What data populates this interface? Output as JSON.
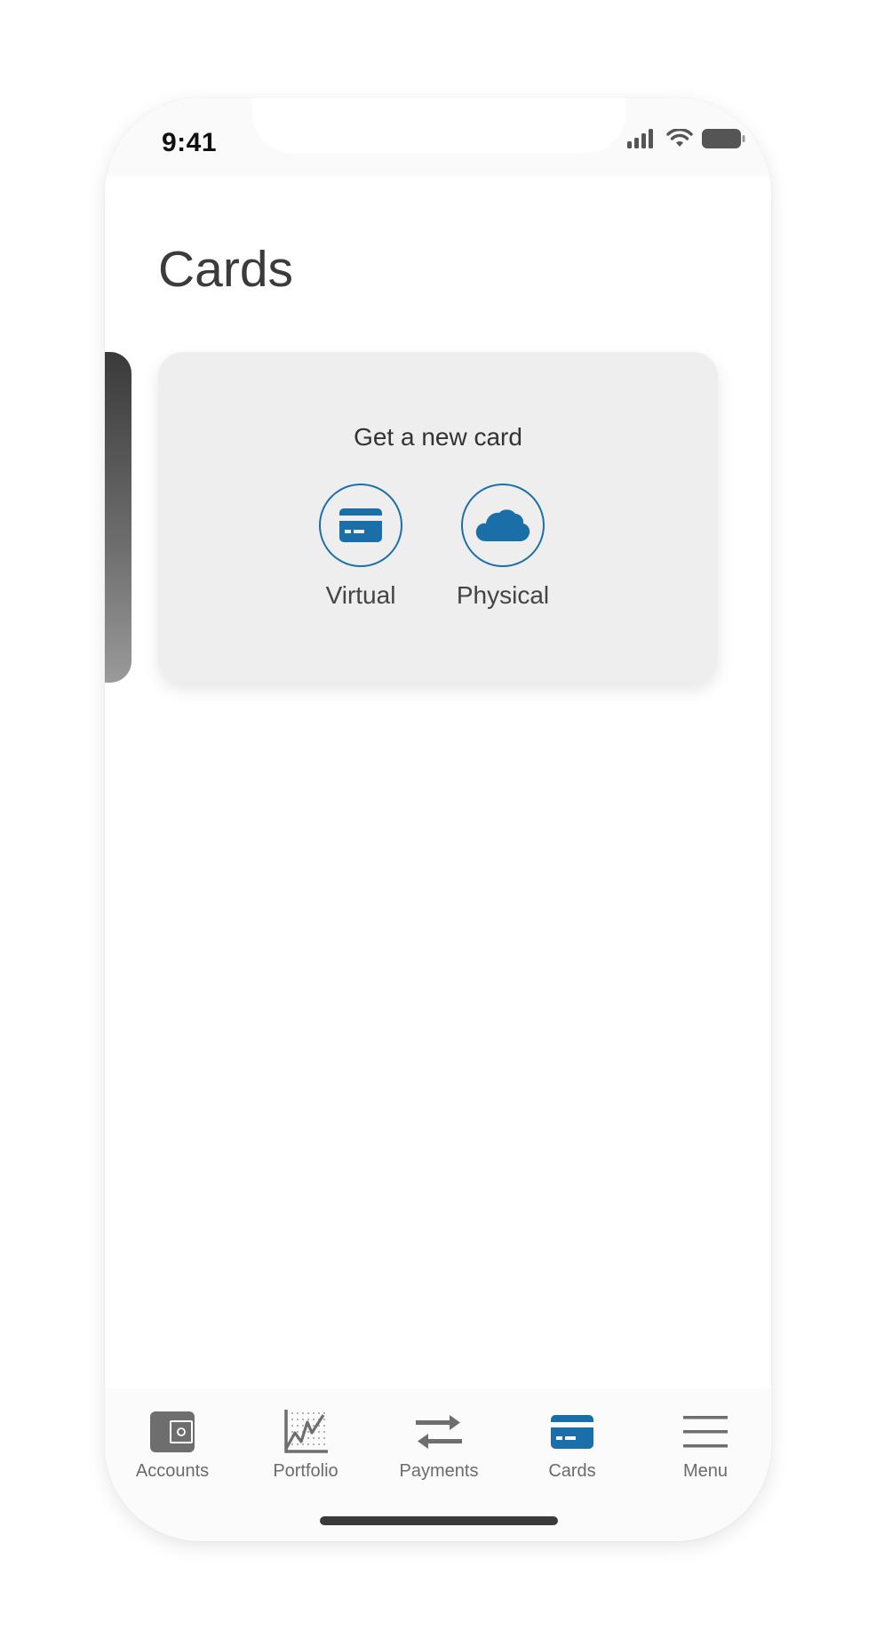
{
  "status_bar": {
    "time": "9:41"
  },
  "page": {
    "title": "Cards"
  },
  "new_card": {
    "title": "Get a new card",
    "options": [
      {
        "label": "Virtual",
        "icon": "credit-card-icon"
      },
      {
        "label": "Physical",
        "icon": "cloud-icon"
      }
    ]
  },
  "tab_bar": {
    "items": [
      {
        "label": "Accounts",
        "icon": "wallet-icon",
        "active": false
      },
      {
        "label": "Portfolio",
        "icon": "chart-icon",
        "active": false
      },
      {
        "label": "Payments",
        "icon": "transfer-arrows-icon",
        "active": false
      },
      {
        "label": "Cards",
        "icon": "credit-card-icon",
        "active": true
      },
      {
        "label": "Menu",
        "icon": "hamburger-menu-icon",
        "active": false
      }
    ]
  },
  "colors": {
    "accent": "#1a6fa8",
    "inactive_icon": "#6e6e6e",
    "title_text": "#3b3b3b",
    "card_background": "#eeeeee"
  }
}
